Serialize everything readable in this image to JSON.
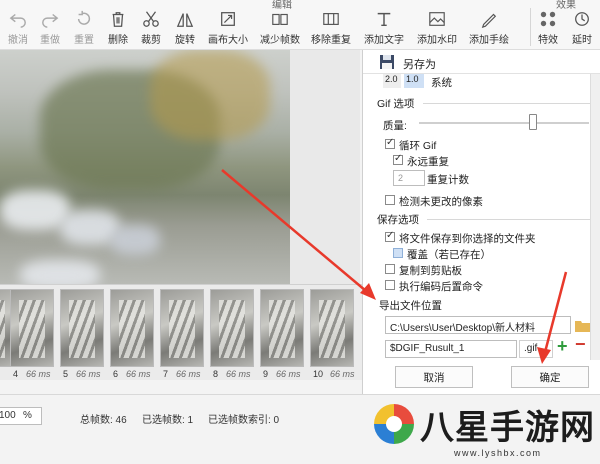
{
  "toolbar": {
    "groups": {
      "edit": "编辑",
      "effects": "效果"
    },
    "items": [
      {
        "label": "撤消",
        "icon": "undo-icon"
      },
      {
        "label": "重做",
        "icon": "redo-icon"
      },
      {
        "label": "重置",
        "icon": "reset-icon"
      },
      {
        "label": "删除",
        "icon": "delete-icon"
      },
      {
        "label": "裁剪",
        "icon": "cut-icon"
      },
      {
        "label": "旋转",
        "icon": "rotate-icon"
      },
      {
        "label": "画布大小",
        "icon": "canvas-size-icon"
      },
      {
        "label": "减少帧数",
        "icon": "reduce-frames-icon"
      },
      {
        "label": "移除重复",
        "icon": "remove-duplicates-icon"
      },
      {
        "label": "添加文字",
        "icon": "add-text-icon"
      },
      {
        "label": "添加水印",
        "icon": "add-watermark-icon"
      },
      {
        "label": "添加手绘",
        "icon": "add-drawing-icon"
      },
      {
        "label": "特效",
        "icon": "effects-icon"
      },
      {
        "label": "延时",
        "icon": "delay-icon"
      }
    ]
  },
  "frames": [
    {
      "num": "4",
      "ms": "66 ms"
    },
    {
      "num": "5",
      "ms": "66 ms"
    },
    {
      "num": "6",
      "ms": "66 ms"
    },
    {
      "num": "7",
      "ms": "66 ms"
    },
    {
      "num": "8",
      "ms": "66 ms"
    },
    {
      "num": "9",
      "ms": "66 ms"
    },
    {
      "num": "10",
      "ms": "66 ms"
    }
  ],
  "dialog": {
    "title": "另存为",
    "version_a": "2.0",
    "version_b": "1.0",
    "version_label": "系统",
    "gif_options": "Gif 选项",
    "quality": "质量:",
    "quality_level": 0.67,
    "loop_gif": "循环 Gif",
    "repeat_forever": "永远重复",
    "repeat_count_value": "2",
    "repeat_count_label": "重复计数",
    "detect_unchanged": "检测未更改的像素",
    "save_options": "保存选项",
    "save_to_folder": "将文件保存到你选择的文件夹",
    "overwrite": "覆盖（若已存在）",
    "copy_clipboard": "复制到剪贴板",
    "run_post_command": "执行编码后置命令",
    "export_location": "导出文件位置",
    "path_value": "C:\\Users\\User\\Desktop\\新人材料",
    "filename_value": "$DGIF_Rusult_1",
    "extension": ".gif",
    "cancel": "取消",
    "confirm": "确定"
  },
  "status": {
    "zoom": "100",
    "zoom_unit": "%",
    "total_frames": "总帧数: 46",
    "selected_frames": "已选帧数: 1",
    "selected_index": "已选帧数索引: 0"
  },
  "watermark": {
    "text": "八星手游网",
    "url": "www.lyshbx.com"
  },
  "colors": {
    "arrow": "#e8392b",
    "highlight": "#cfe0f5"
  }
}
